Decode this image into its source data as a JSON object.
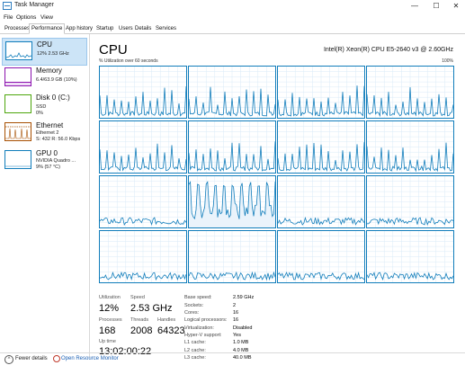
{
  "window": {
    "title": "Task Manager",
    "minimize_glyph": "—",
    "maximize_glyph": "☐",
    "close_glyph": "✕"
  },
  "menu": [
    "File",
    "Options",
    "View"
  ],
  "tabs": [
    {
      "label": "Processes",
      "active": false
    },
    {
      "label": "Performance",
      "active": true
    },
    {
      "label": "App history",
      "active": false
    },
    {
      "label": "Startup",
      "active": false
    },
    {
      "label": "Users",
      "active": false
    },
    {
      "label": "Details",
      "active": false
    },
    {
      "label": "Services",
      "active": false
    }
  ],
  "sidebar": {
    "items": [
      {
        "title": "CPU",
        "sub1": "12%  2.53 GHz",
        "sub2": "",
        "color": "#117dbb",
        "icon": "cpu-graph-icon"
      },
      {
        "title": "Memory",
        "sub1": "6.4/63.9 GB (10%)",
        "sub2": "",
        "color": "#8b12ae",
        "icon": "memory-graph-icon"
      },
      {
        "title": "Disk 0 (C:)",
        "sub1": "SSD",
        "sub2": "0%",
        "color": "#4da60c",
        "icon": "disk-graph-icon"
      },
      {
        "title": "Ethernet",
        "sub1": "Ethernet 2",
        "sub2": "S: 432  R: 56.0 Kbps",
        "color": "#a74f01",
        "icon": "ethernet-graph-icon"
      },
      {
        "title": "GPU 0",
        "sub1": "NVIDIA Quadro ...",
        "sub2": "9%  (57 °C)",
        "color": "#117dbb",
        "icon": "gpu-graph-icon"
      }
    ]
  },
  "cpu": {
    "title": "CPU",
    "model": "Intel(R) Xeon(R) CPU E5-2640 v3 @ 2.60GHz",
    "graph_caption": "% Utilization over 60 seconds",
    "graph_max": "100%",
    "graph_color": "#117dbb",
    "grid_color": "#d9eaf7",
    "core_count": 16
  },
  "stats": {
    "utilization": {
      "label": "Utilization",
      "value": "12%"
    },
    "speed": {
      "label": "Speed",
      "value": "2.53 GHz"
    },
    "processes": {
      "label": "Processes",
      "value": "168"
    },
    "threads": {
      "label": "Threads",
      "value": "2008"
    },
    "handles": {
      "label": "Handles",
      "value": "64323"
    },
    "uptime": {
      "label": "Up time",
      "value": "13:02:00:22"
    }
  },
  "specs": [
    {
      "label": "Base speed:",
      "value": "2.59 GHz"
    },
    {
      "label": "Sockets:",
      "value": "2"
    },
    {
      "label": "Cores:",
      "value": "16"
    },
    {
      "label": "Logical processors:",
      "value": "16"
    },
    {
      "label": "Virtualization:",
      "value": "Disabled"
    },
    {
      "label": "Hyper-V support:",
      "value": "Yes"
    },
    {
      "label": "L1 cache:",
      "value": "1.0 MB"
    },
    {
      "label": "L2 cache:",
      "value": "4.0 MB"
    },
    {
      "label": "L3 cache:",
      "value": "40.0 MB"
    }
  ],
  "footer": {
    "fewer_details": "Fewer details",
    "open_resource_monitor": "Open Resource Monitor"
  }
}
